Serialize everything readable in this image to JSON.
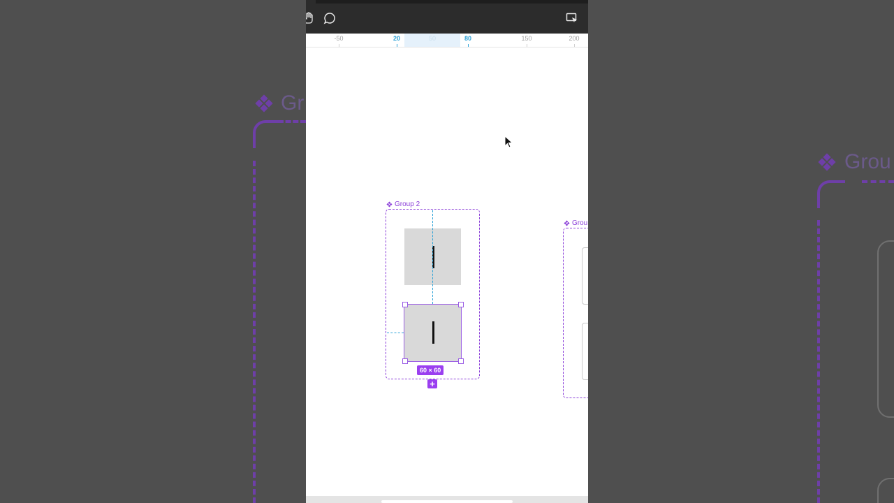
{
  "ruler": {
    "ticks": [
      "-50",
      "20",
      "50",
      "80",
      "150",
      "200"
    ]
  },
  "canvas": {
    "group_primary_label": "Group 2",
    "group_secondary_label": "Grou",
    "size_badge": "60 × 60",
    "add_button_label": "+"
  },
  "background": {
    "left_label": "Gr",
    "right_label": "Grou"
  },
  "toolbar": {
    "icons": [
      "hand-icon",
      "comment-icon",
      "present-icon"
    ]
  },
  "colors": {
    "accent_purple": "#8b3fd9",
    "guide_blue": "#2ea3d8",
    "toolbar_bg": "#2c2c2c",
    "backdrop": "#4f4f4f"
  }
}
